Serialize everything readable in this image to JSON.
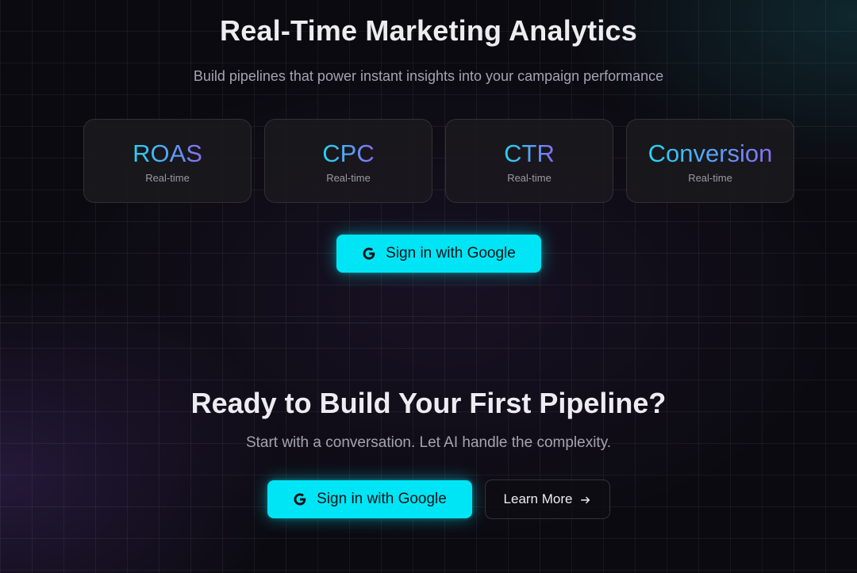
{
  "hero": {
    "title": "Real-Time Marketing Analytics",
    "subtitle": "Build pipelines that power instant insights into your campaign performance",
    "metrics": [
      {
        "value": "ROAS",
        "label": "Real-time"
      },
      {
        "value": "CPC",
        "label": "Real-time"
      },
      {
        "value": "CTR",
        "label": "Real-time"
      },
      {
        "value": "Conversion",
        "label": "Real-time"
      }
    ],
    "signin_label": "Sign in with Google",
    "signin_icon": "google-g-icon"
  },
  "cta": {
    "title": "Ready to Build Your First Pipeline?",
    "subtitle": "Start with a conversation. Let AI handle the complexity.",
    "signin_label": "Sign in with Google",
    "signin_icon": "google-g-icon",
    "learn_more_label": "Learn More",
    "learn_more_icon": "arrow-right-icon"
  },
  "colors": {
    "accent": "#00e5f5",
    "gradient_start": "#26d3f2",
    "gradient_end": "#8a6cf2",
    "background": "#0b0a10"
  }
}
